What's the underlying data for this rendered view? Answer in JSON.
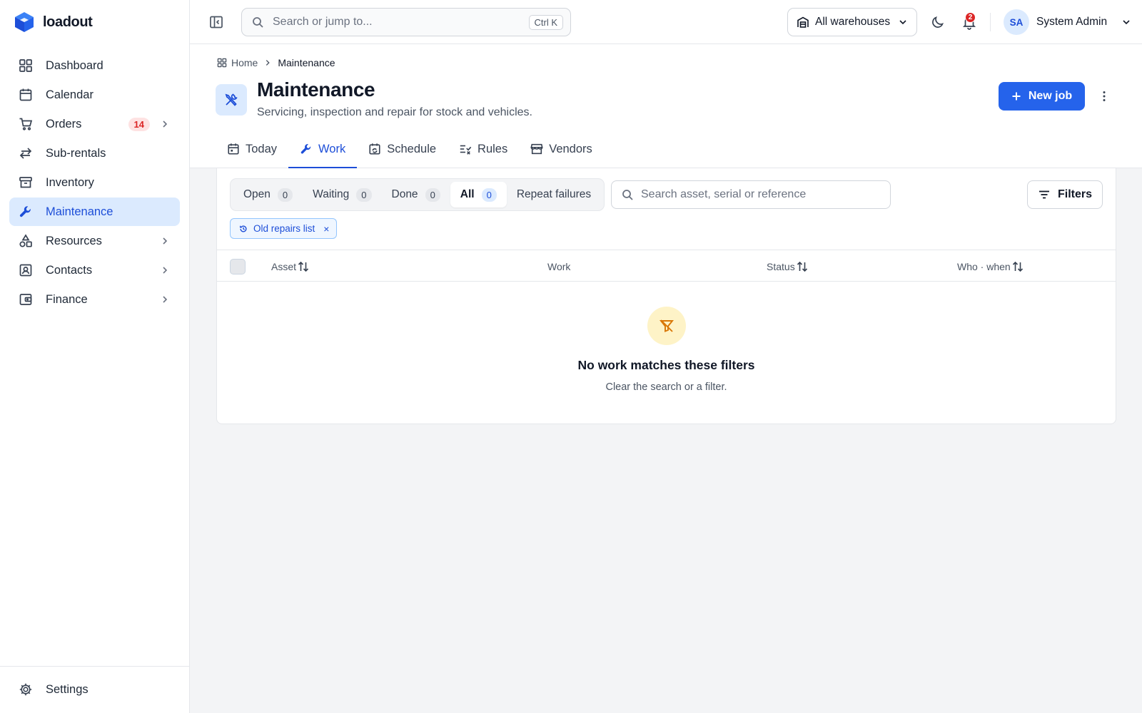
{
  "app": {
    "name": "loadout",
    "logo_icon": "cube-logo-icon",
    "accent": "#2563eb"
  },
  "sidebar": {
    "items": [
      {
        "label": "Dashboard",
        "icon": "dashboard-grid-icon"
      },
      {
        "label": "Calendar",
        "icon": "calendar-icon"
      },
      {
        "label": "Orders",
        "icon": "cart-icon",
        "badge": "14"
      },
      {
        "label": "Sub-rentals",
        "icon": "swap-arrows-icon"
      },
      {
        "label": "Inventory",
        "icon": "archive-box-icon"
      },
      {
        "label": "Maintenance",
        "icon": "wrench-icon",
        "active": true
      },
      {
        "label": "Resources",
        "icon": "shapes-icon"
      },
      {
        "label": "Contacts",
        "icon": "contact-card-icon"
      },
      {
        "label": "Finance",
        "icon": "wallet-icon"
      }
    ],
    "footer": {
      "label": "Settings",
      "icon": "gear-icon"
    }
  },
  "topbar": {
    "search_placeholder": "Search or jump to...",
    "shortcut": "Ctrl K",
    "warehouse": "All warehouses",
    "notification_count": "2",
    "user": {
      "initials": "SA",
      "name": "System Admin"
    }
  },
  "breadcrumb": {
    "home": "Home",
    "current": "Maintenance"
  },
  "page": {
    "title": "Maintenance",
    "subtitle": "Servicing, inspection and repair for stock and vehicles.",
    "primary_action": "New job"
  },
  "tabs": [
    {
      "label": "Today",
      "icon": "calendar-icon"
    },
    {
      "label": "Work",
      "icon": "wrench-icon",
      "active": true
    },
    {
      "label": "Schedule",
      "icon": "calendar-repeat-icon"
    },
    {
      "label": "Rules",
      "icon": "checklist-icon"
    },
    {
      "label": "Vendors",
      "icon": "store-icon"
    }
  ],
  "status_filter": [
    {
      "label": "Open",
      "count": "0"
    },
    {
      "label": "Waiting",
      "count": "0"
    },
    {
      "label": "Done",
      "count": "0"
    },
    {
      "label": "All",
      "count": "0",
      "active": true
    },
    {
      "label": "Repeat failures"
    }
  ],
  "table_search_placeholder": "Search asset, serial or reference",
  "filters_label": "Filters",
  "active_chip": "Old repairs list",
  "columns": {
    "asset": "Asset",
    "work": "Work",
    "status": "Status",
    "who_when": "Who · when"
  },
  "empty_state": {
    "title": "No work matches these filters",
    "subtitle": "Clear the search or a filter.",
    "icon": "filter-off-icon",
    "icon_color": "#d97706"
  }
}
